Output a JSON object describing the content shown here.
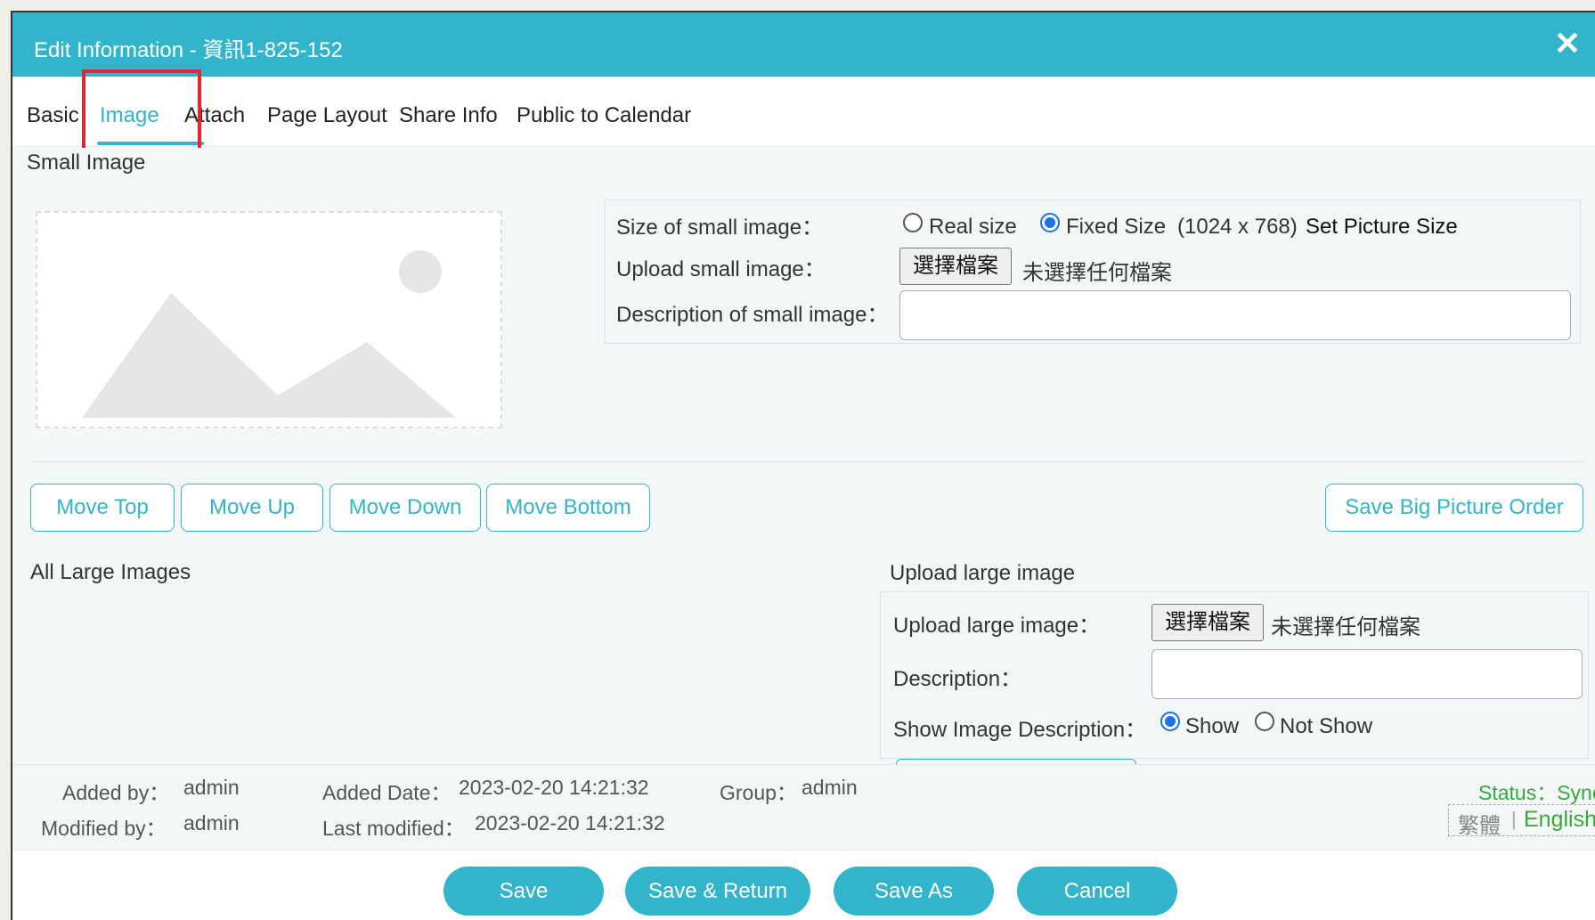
{
  "window": {
    "title": "Edit Information - 資訊1-825-152",
    "close_symbol": "✕"
  },
  "tabs": [
    {
      "label": "Basic"
    },
    {
      "label": "Image"
    },
    {
      "label": "Attach"
    },
    {
      "label": "Page Layout"
    },
    {
      "label": "Share Info"
    },
    {
      "label": "Public to Calendar"
    }
  ],
  "small_image": {
    "heading": "Small Image",
    "size_label": "Size of small image：",
    "size_options": [
      {
        "label": "Real size",
        "checked": false
      },
      {
        "label": "Fixed Size",
        "checked": true
      }
    ],
    "fixed_size_dims": "(1024 x 768)",
    "set_size_link": "Set Picture Size",
    "upload_label": "Upload small image：",
    "file_button": "選擇檔案",
    "no_file_text": "未選擇任何檔案",
    "description_label": "Description of small image：",
    "description_value": ""
  },
  "order_buttons": {
    "move_top": "Move Top",
    "move_up": "Move Up",
    "move_down": "Move Down",
    "move_bottom": "Move Bottom",
    "save_order": "Save Big Picture Order"
  },
  "large_images": {
    "heading": "All Large Images",
    "upload_heading": "Upload large image",
    "upload_label": "Upload large image：",
    "file_button": "選擇檔案",
    "no_file_text": "未選擇任何檔案",
    "description_label": "Description：",
    "description_value": "",
    "show_desc_label": "Show Image Description：",
    "show_options": [
      {
        "label": "Show",
        "checked": true
      },
      {
        "label": "Not Show",
        "checked": false
      }
    ]
  },
  "footer": {
    "added_by_label": "Added by：",
    "added_by": "admin",
    "added_date_label": "Added Date：",
    "added_date": "2023-02-20 14:21:32",
    "group_label": "Group：",
    "group": "admin",
    "modified_by_label": "Modified by：",
    "modified_by": "admin",
    "last_modified_label": "Last modified：",
    "last_modified": "2023-02-20 14:21:32",
    "status_text": "Status：Sync",
    "lang_trad": "繁體",
    "lang_sep": "|",
    "lang_en": "English"
  },
  "actions": {
    "save": "Save",
    "save_return": "Save & Return",
    "save_as": "Save As",
    "cancel": "Cancel"
  },
  "colors": {
    "brand": "#32b4ca",
    "status_green": "#3aa83a",
    "highlight_red": "#e0282e",
    "radio_blue": "#1a73e8"
  }
}
